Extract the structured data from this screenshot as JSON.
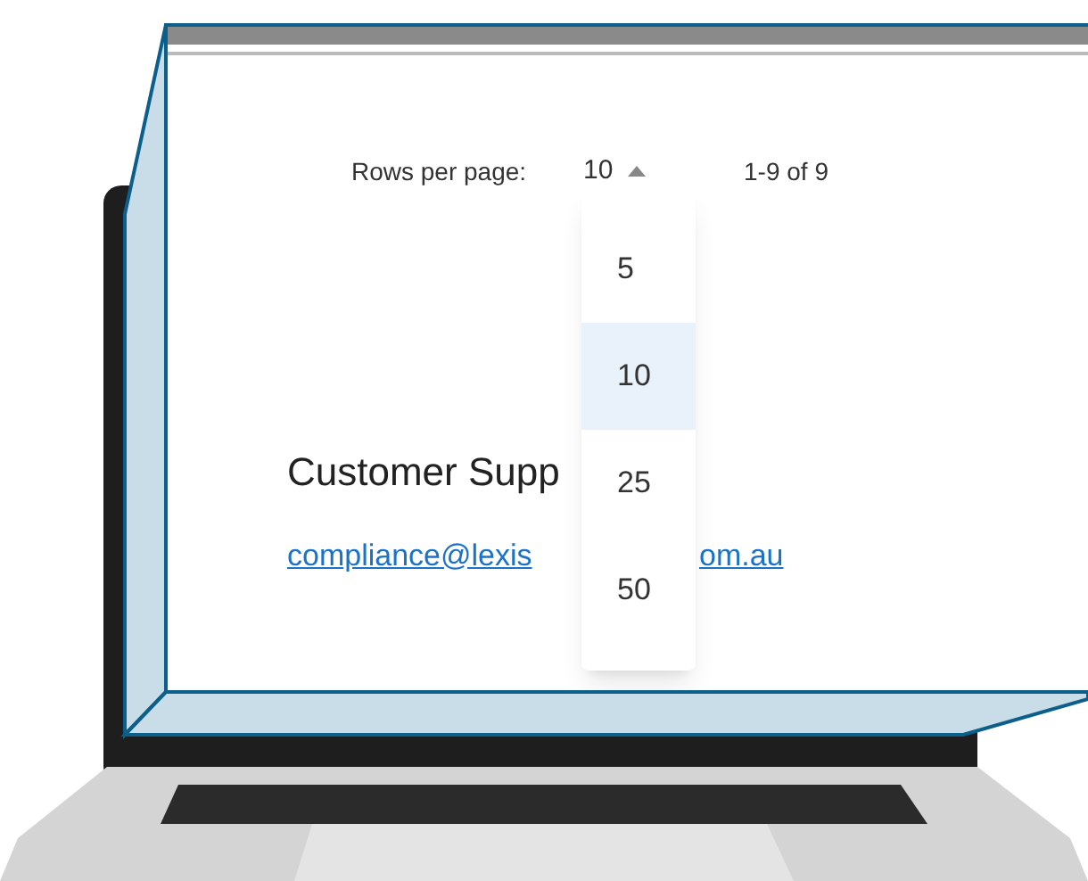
{
  "pagination": {
    "label": "Rows per page:",
    "value": "10",
    "range": "1-9 of 9",
    "menu_open": true
  },
  "rows_per_page_options": [
    {
      "label": "5",
      "selected": false
    },
    {
      "label": "10",
      "selected": true
    },
    {
      "label": "25",
      "selected": false
    },
    {
      "label": "50",
      "selected": false
    }
  ],
  "support": {
    "heading": "Customer Supp",
    "email_parts": [
      "compliance@lexis",
      "om.au"
    ]
  }
}
